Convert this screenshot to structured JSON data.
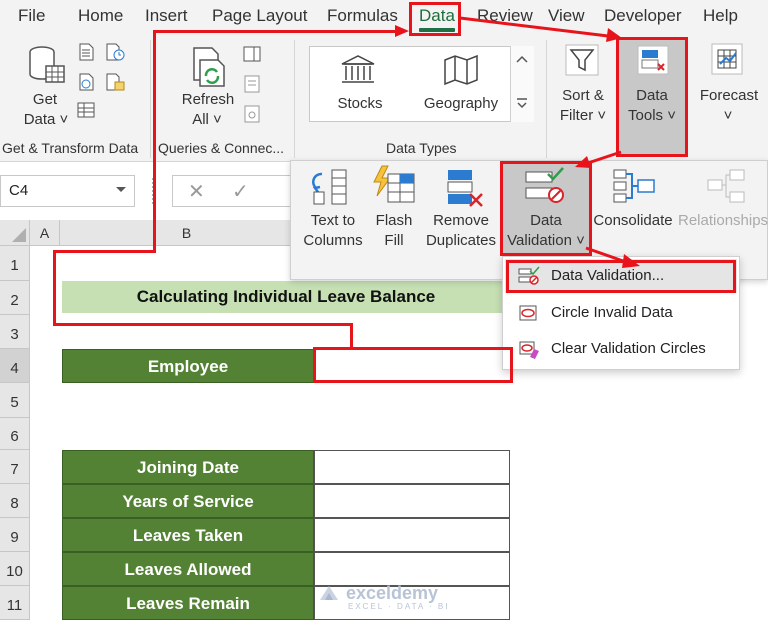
{
  "menu": {
    "file": "File",
    "home": "Home",
    "insert": "Insert",
    "page_layout": "Page Layout",
    "formulas": "Formulas",
    "data": "Data",
    "review": "Review",
    "view": "View",
    "developer": "Developer",
    "help": "Help"
  },
  "ribbon": {
    "get_data_1": "Get",
    "get_data_2": "Data ˅",
    "refresh_1": "Refresh",
    "refresh_2": "All ˅",
    "stocks": "Stocks",
    "geography": "Geography",
    "sort_filter_1": "Sort &",
    "sort_filter_2": "Filter ˅",
    "data_tools_1": "Data",
    "data_tools_2": "Tools ˅",
    "forecast": "Forecast",
    "forecast_caret": "˅",
    "group_get_transform": "Get & Transform Data",
    "group_queries": "Queries & Connec...",
    "group_data_types": "Data Types"
  },
  "formula_bar": {
    "name_box": "C4",
    "cancel": "✕",
    "enter": "✓"
  },
  "data_tools_panel": {
    "text_to_columns_1": "Text to",
    "text_to_columns_2": "Columns",
    "flash_fill_1": "Flash",
    "flash_fill_2": "Fill",
    "remove_duplicates_1": "Remove",
    "remove_duplicates_2": "Duplicates",
    "data_validation_1": "Data",
    "data_validation_2": "Validation ˅",
    "consolidate": "Consolidate",
    "relationships": "Relationships"
  },
  "validation_menu": {
    "item1": "Data Validation...",
    "item2": "Circle Invalid Data",
    "item3": "Clear Validation Circles"
  },
  "sheet": {
    "col_a": "A",
    "col_b": "B",
    "rows": [
      "1",
      "2",
      "3",
      "4",
      "5",
      "6",
      "7",
      "8",
      "9",
      "10",
      "11"
    ],
    "title": "Calculating Individual Leave Balance",
    "employee": "Employee",
    "joining_date": "Joining Date",
    "years_of_service": "Years of Service",
    "leaves_taken": "Leaves Taken",
    "leaves_allowed": "Leaves Allowed",
    "leaves_remain": "Leaves Remain"
  },
  "watermark": {
    "name": "exceldemy",
    "tagline": "EXCEL · DATA · BI"
  }
}
